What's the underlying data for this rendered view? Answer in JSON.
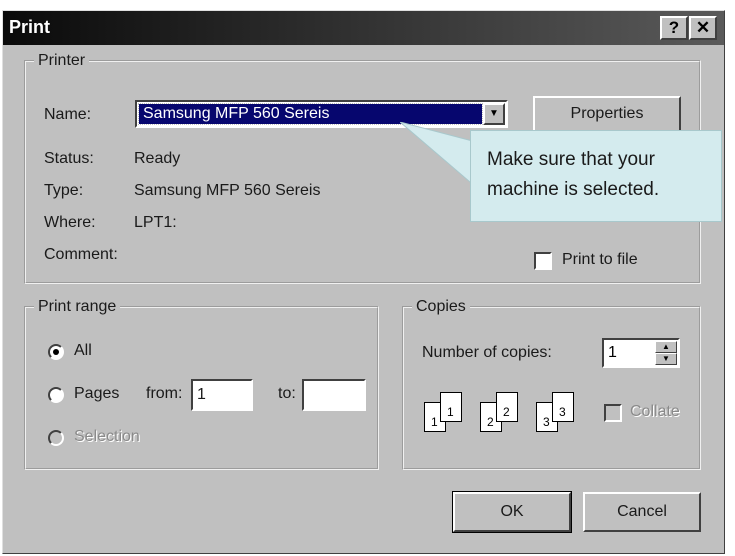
{
  "window": {
    "title": "Print",
    "help_label": "?",
    "close_label": "✕"
  },
  "printer": {
    "group_label": "Printer",
    "name_label": "Name:",
    "name_value": "Samsung MFP 560 Sereis",
    "properties_label": "Properties",
    "status_label": "Status:",
    "status_value": "Ready",
    "type_label": "Type:",
    "type_value": "Samsung MFP 560 Sereis",
    "where_label": "Where:",
    "where_value": "LPT1:",
    "comment_label": "Comment:",
    "print_to_file_label": "Print to file",
    "print_to_file_checked": false
  },
  "callout": {
    "line1": "Make sure that your",
    "line2": "machine is selected."
  },
  "print_range": {
    "group_label": "Print range",
    "all_label": "All",
    "pages_label": "Pages",
    "from_label": "from:",
    "from_value": "1",
    "to_label": "to:",
    "to_value": "",
    "selection_label": "Selection",
    "selected": "All"
  },
  "copies": {
    "group_label": "Copies",
    "number_label": "Number of copies:",
    "number_value": "1",
    "collate_label": "Collate",
    "collate_enabled": false,
    "page_numbers": [
      "1",
      "1",
      "2",
      "2",
      "3",
      "3"
    ]
  },
  "buttons": {
    "ok_label": "OK",
    "cancel_label": "Cancel"
  },
  "colors": {
    "dialog_bg": "#c0c0c0",
    "selection_bg": "#06066e",
    "callout_bg": "#d4ebee"
  },
  "icons": {
    "dropdown": "chevron-down-icon",
    "spin_up": "triangle-up-icon",
    "spin_down": "triangle-down-icon",
    "collate": "collate-pages-icon"
  }
}
